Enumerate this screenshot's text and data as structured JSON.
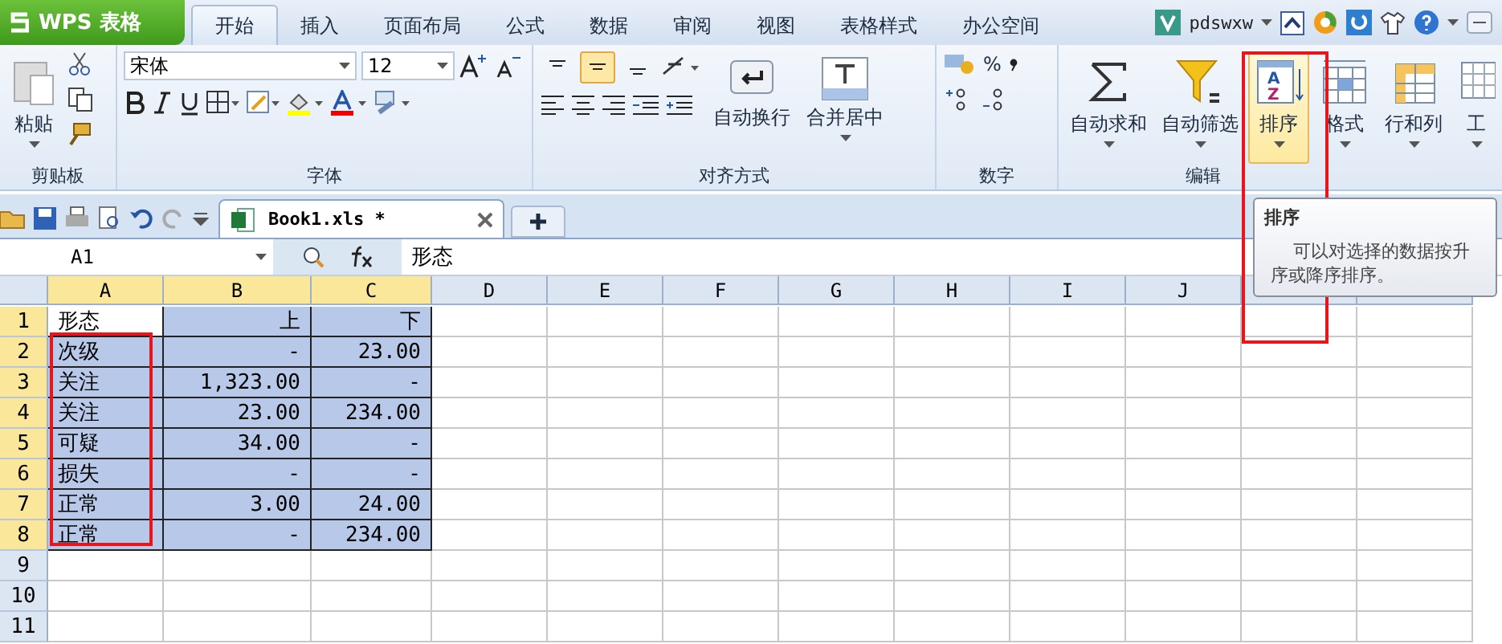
{
  "app_button": {
    "label": "WPS 表格"
  },
  "menu_tabs": [
    {
      "label": "开始",
      "selected": true
    },
    {
      "label": "插入",
      "selected": false
    },
    {
      "label": "页面布局",
      "selected": false
    },
    {
      "label": "公式",
      "selected": false
    },
    {
      "label": "数据",
      "selected": false
    },
    {
      "label": "审阅",
      "selected": false
    },
    {
      "label": "视图",
      "selected": false
    },
    {
      "label": "表格样式",
      "selected": false
    },
    {
      "label": "办公空间",
      "selected": false
    }
  ],
  "account": {
    "user": "pdswxw"
  },
  "ribbon": {
    "clipboard": {
      "label": "剪贴板",
      "paste": "粘贴"
    },
    "font": {
      "label": "字体",
      "font_name": "宋体",
      "font_size": "12"
    },
    "alignment": {
      "label": "对齐方式",
      "valign": [
        {
          "selected": false
        },
        {
          "selected": true
        },
        {
          "selected": false
        }
      ],
      "wrap": "自动换行",
      "merge": "合并居中"
    },
    "number": {
      "label": "数字",
      "percent": "%"
    },
    "editing": {
      "label": "编辑",
      "tools": [
        {
          "kind": "sum",
          "label": "自动求和",
          "highlighted": false
        },
        {
          "kind": "filter",
          "label": "自动筛选",
          "highlighted": false
        },
        {
          "kind": "sort",
          "label": "排序",
          "highlighted": true,
          "icon_text": [
            "A",
            "Z"
          ]
        },
        {
          "kind": "format",
          "label": "格式",
          "highlighted": false
        },
        {
          "kind": "rowcol",
          "label": "行和列",
          "highlighted": false
        },
        {
          "kind": "sheet",
          "label": "工",
          "highlighted": false
        }
      ]
    }
  },
  "document_tabs": [
    {
      "title": "Book1.xls *",
      "selected": true
    }
  ],
  "formula_bar": {
    "cell_ref": "A1",
    "content": "形态"
  },
  "sheet": {
    "columns": [
      {
        "label": "A",
        "selected": true
      },
      {
        "label": "B",
        "selected": true
      },
      {
        "label": "C",
        "selected": true
      },
      {
        "label": "D",
        "selected": false
      },
      {
        "label": "E",
        "selected": false
      },
      {
        "label": "F",
        "selected": false
      },
      {
        "label": "G",
        "selected": false
      },
      {
        "label": "H",
        "selected": false
      },
      {
        "label": "I",
        "selected": false
      },
      {
        "label": "J",
        "selected": false
      }
    ],
    "rows": [
      {
        "number": "1",
        "selected": true,
        "cells": [
          "形态",
          "上",
          "下"
        ]
      },
      {
        "number": "2",
        "selected": true,
        "cells": [
          "次级",
          "-",
          "23.00"
        ]
      },
      {
        "number": "3",
        "selected": true,
        "cells": [
          "关注",
          "1,323.00",
          "-"
        ]
      },
      {
        "number": "4",
        "selected": true,
        "cells": [
          "关注",
          "23.00",
          "234.00"
        ]
      },
      {
        "number": "5",
        "selected": true,
        "cells": [
          "可疑",
          "34.00",
          "-"
        ]
      },
      {
        "number": "6",
        "selected": true,
        "cells": [
          "损失",
          "-",
          "-"
        ]
      },
      {
        "number": "7",
        "selected": true,
        "cells": [
          "正常",
          "3.00",
          "24.00"
        ]
      },
      {
        "number": "8",
        "selected": true,
        "cells": [
          "正常",
          "-",
          "234.00"
        ]
      },
      {
        "number": "9",
        "selected": false,
        "cells": []
      },
      {
        "number": "10",
        "selected": false,
        "cells": []
      },
      {
        "number": "11",
        "selected": false,
        "cells": []
      }
    ]
  },
  "tooltip": {
    "title": "排序",
    "text": "可以对选择的数据按升序或降序排序。"
  }
}
